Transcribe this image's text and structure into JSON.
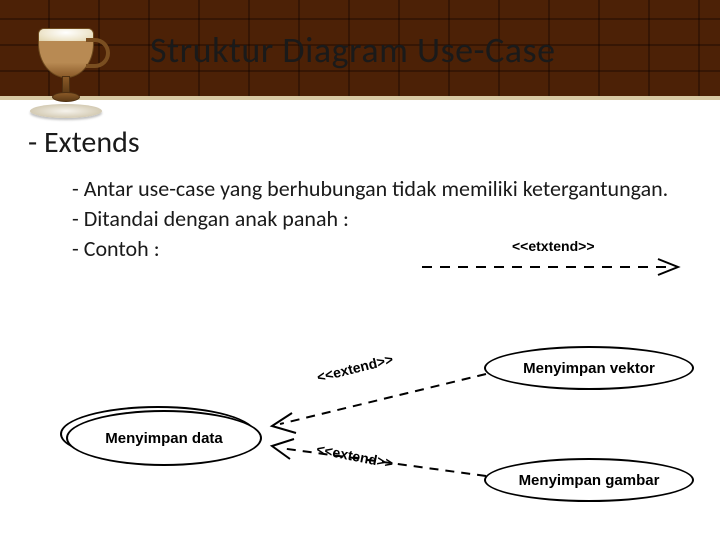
{
  "slide": {
    "title": "Struktur Diagram Use-Case",
    "section": "Extends",
    "bullets": [
      "Antar use-case yang berhubungan tidak memiliki ketergantungan.",
      "Ditandai dengan anak panah :",
      "Contoh :"
    ]
  },
  "arrow_inline": {
    "stereotype": "<<etxtend>>"
  },
  "diagram": {
    "usecases": {
      "main": "Menyimpan data",
      "vector": "Menyimpan vektor",
      "image": "Menyimpan gambar"
    },
    "edges": {
      "top_stereotype": "<<extend>>",
      "bottom_stereotype": "<<extend>>"
    }
  }
}
